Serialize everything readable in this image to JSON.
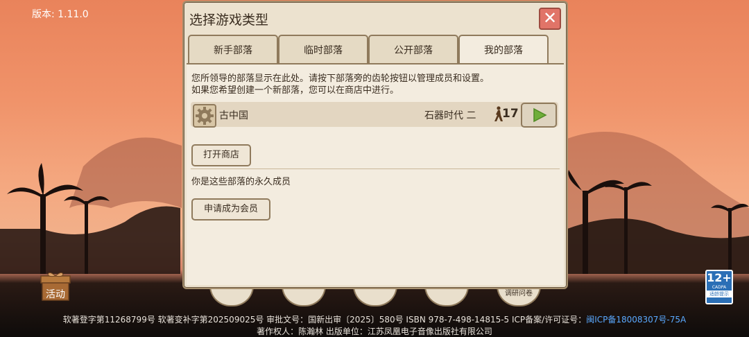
{
  "version_label": "版本: 1.11.0",
  "dialog": {
    "title": "选择游戏类型",
    "close_symbol": "✕",
    "tabs": [
      {
        "label": "新手部落",
        "active": false
      },
      {
        "label": "临时部落",
        "active": false
      },
      {
        "label": "公开部落",
        "active": false
      },
      {
        "label": "我的部落",
        "active": true
      }
    ],
    "description_line1": "您所领导的部落显示在此处。请按下部落旁的齿轮按钮以管理成员和设置。",
    "description_line2": "如果您希望创建一个新部落，您可以在商店中进行。",
    "tribe": {
      "name": "古中国",
      "era": "石器时代 二",
      "member_count": "17"
    },
    "open_shop_label": "打开商店",
    "permanent_member_text": "你是这些部落的永久成员",
    "apply_member_label": "申请成为会员"
  },
  "activity_label": "活动",
  "survey_label": "调研问卷",
  "age_badge": {
    "age": "12+",
    "org": "CADPA",
    "tip": "适龄提示"
  },
  "footer": {
    "line1": "软著登字第11268799号 软著变补字第202509025号 审批文号：国新出审〔2025〕580号 ISBN 978-7-498-14815-5 ICP备案/许可证号：",
    "icp": "闽ICP备18008307号-75A",
    "line2": "著作权人：陈瀚林 出版单位：江苏凤凰电子音像出版社有限公司"
  },
  "colors": {
    "accent_play": "#6fae3a",
    "close_red": "#e17468",
    "panel": "#f3ecdf",
    "border": "#8f7a5c"
  }
}
